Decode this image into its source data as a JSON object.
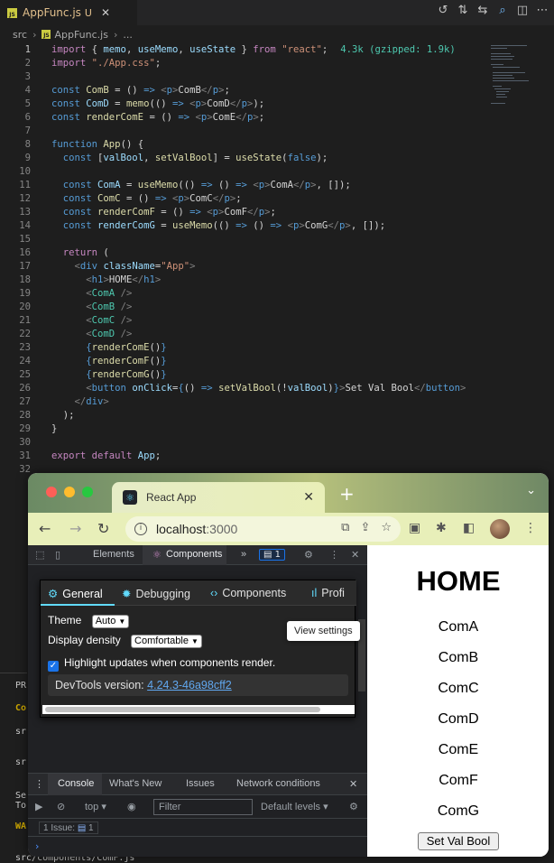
{
  "vscode": {
    "tab": {
      "name": "AppFunc.js",
      "status": "U",
      "close": "✕"
    },
    "breadcrumb": [
      "src",
      "AppFunc.js",
      "..."
    ],
    "import_hint": "4.3k (gzipped: 1.9k)",
    "line_numbers": [
      "1",
      "2",
      "3",
      "4",
      "5",
      "6",
      "7",
      "8",
      "9",
      "10",
      "11",
      "12",
      "13",
      "14",
      "15",
      "16",
      "17",
      "18",
      "19",
      "20",
      "21",
      "22",
      "23",
      "24",
      "25",
      "26",
      "27",
      "28",
      "29",
      "30",
      "31",
      "32"
    ],
    "panel": {
      "texts": [
        "PR",
        "Co",
        "sr",
        "sr",
        "Se",
        "To",
        "WA"
      ],
      "bottom_path": "src/components/ComF.js"
    }
  },
  "chrome": {
    "tab_title": "React App",
    "tab_close": "✕",
    "new_tab": "+",
    "url_host": "localhost",
    "url_port": ":3000",
    "devtools": {
      "tabs": {
        "elements": "Elements",
        "components": "Components",
        "more": "»",
        "messages": "1"
      },
      "settings": {
        "tabs": [
          "General",
          "Debugging",
          "Components",
          "Profi"
        ],
        "theme_label": "Theme",
        "theme_value": "Auto",
        "density_label": "Display density",
        "density_value": "Comfortable",
        "highlight_label": "Highlight updates when components render.",
        "version_label": "DevTools version:",
        "version_value": "4.24.3-46a98cff2"
      },
      "tooltip": "View settings",
      "drawer": {
        "tabs": [
          "Console",
          "What's New",
          "Issues",
          "Network conditions"
        ],
        "context": "top",
        "filter_placeholder": "Filter",
        "levels": "Default levels",
        "issues": "1 Issue:",
        "issues_count": "1"
      }
    },
    "page": {
      "heading": "HOME",
      "components": [
        "ComA",
        "ComB",
        "ComC",
        "ComD",
        "ComE",
        "ComF",
        "ComG"
      ],
      "button": "Set Val Bool"
    }
  },
  "colors": {
    "keyword": "#569cd6",
    "control": "#c586c0",
    "string": "#ce9178",
    "variable": "#9cdcfe",
    "function": "#dcdcaa",
    "react_accent": "#61dafb"
  }
}
